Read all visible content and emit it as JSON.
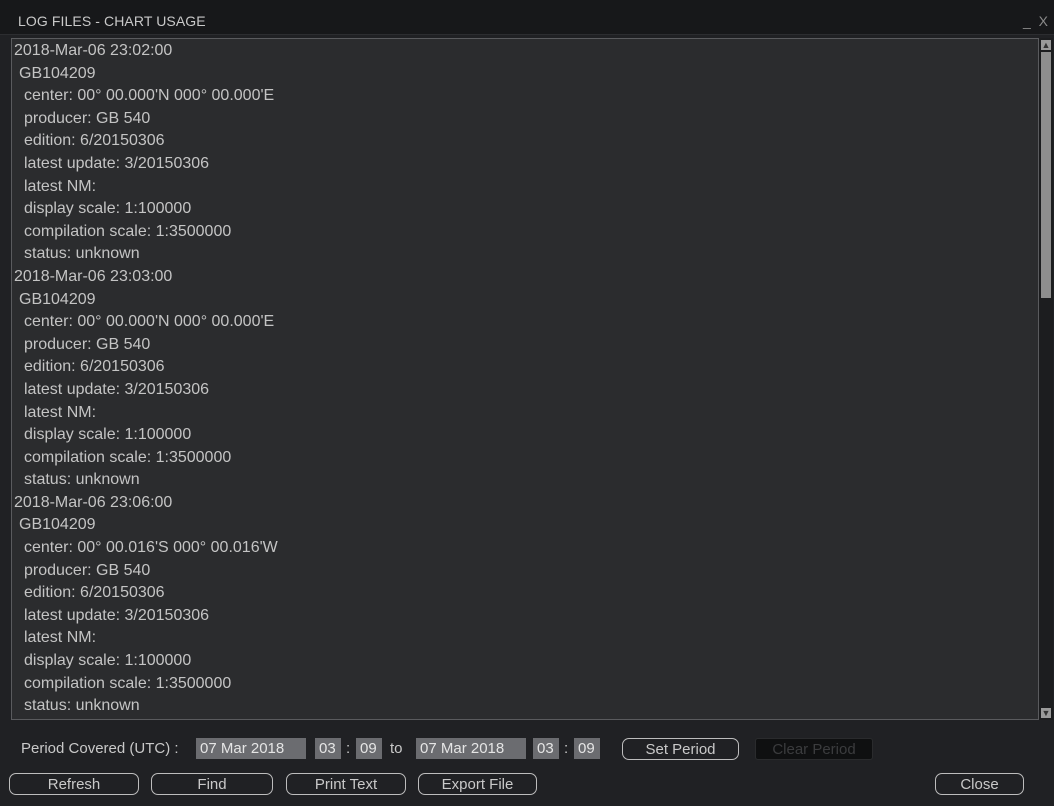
{
  "window": {
    "title": "LOG FILES - CHART USAGE",
    "controls": "_ X"
  },
  "log_lines": [
    {
      "text": "2018-Mar-06 23:02:00",
      "indent": 0
    },
    {
      "text": "GB104209",
      "indent": 1
    },
    {
      "text": "center: 00° 00.000'N 000° 00.000'E",
      "indent": 2
    },
    {
      "text": "producer: GB 540",
      "indent": 2
    },
    {
      "text": "edition: 6/20150306",
      "indent": 2
    },
    {
      "text": "latest update: 3/20150306",
      "indent": 2
    },
    {
      "text": "latest NM:",
      "indent": 2
    },
    {
      "text": "display scale: 1:100000",
      "indent": 2
    },
    {
      "text": "compilation scale: 1:3500000",
      "indent": 2
    },
    {
      "text": "status: unknown",
      "indent": 2
    },
    {
      "text": "2018-Mar-06 23:03:00",
      "indent": 0
    },
    {
      "text": "GB104209",
      "indent": 1
    },
    {
      "text": "center: 00° 00.000'N 000° 00.000'E",
      "indent": 2
    },
    {
      "text": "producer: GB 540",
      "indent": 2
    },
    {
      "text": "edition: 6/20150306",
      "indent": 2
    },
    {
      "text": "latest update: 3/20150306",
      "indent": 2
    },
    {
      "text": "latest NM:",
      "indent": 2
    },
    {
      "text": "display scale: 1:100000",
      "indent": 2
    },
    {
      "text": "compilation scale: 1:3500000",
      "indent": 2
    },
    {
      "text": "status: unknown",
      "indent": 2
    },
    {
      "text": "2018-Mar-06 23:06:00",
      "indent": 0
    },
    {
      "text": "GB104209",
      "indent": 1
    },
    {
      "text": "center: 00° 00.016'S 000° 00.016'W",
      "indent": 2
    },
    {
      "text": "producer: GB 540",
      "indent": 2
    },
    {
      "text": "edition: 6/20150306",
      "indent": 2
    },
    {
      "text": "latest update: 3/20150306",
      "indent": 2
    },
    {
      "text": "latest NM:",
      "indent": 2
    },
    {
      "text": "display scale: 1:100000",
      "indent": 2
    },
    {
      "text": "compilation scale: 1:3500000",
      "indent": 2
    },
    {
      "text": "status: unknown",
      "indent": 2
    }
  ],
  "scrollbar": {
    "up_icon": "▲",
    "down_icon": "▼"
  },
  "period": {
    "label": "Period Covered (UTC) :",
    "from_date": "07 Mar 2018",
    "from_hour": "03",
    "from_min": "09",
    "sep": ":",
    "to_label": "to",
    "to_date": "07 Mar 2018",
    "to_hour": "03",
    "to_min": "09",
    "set_label": "Set Period",
    "clear_label": "Clear Period"
  },
  "buttons": {
    "refresh": "Refresh",
    "find": "Find",
    "print": "Print Text",
    "export": "Export File",
    "close": "Close"
  }
}
